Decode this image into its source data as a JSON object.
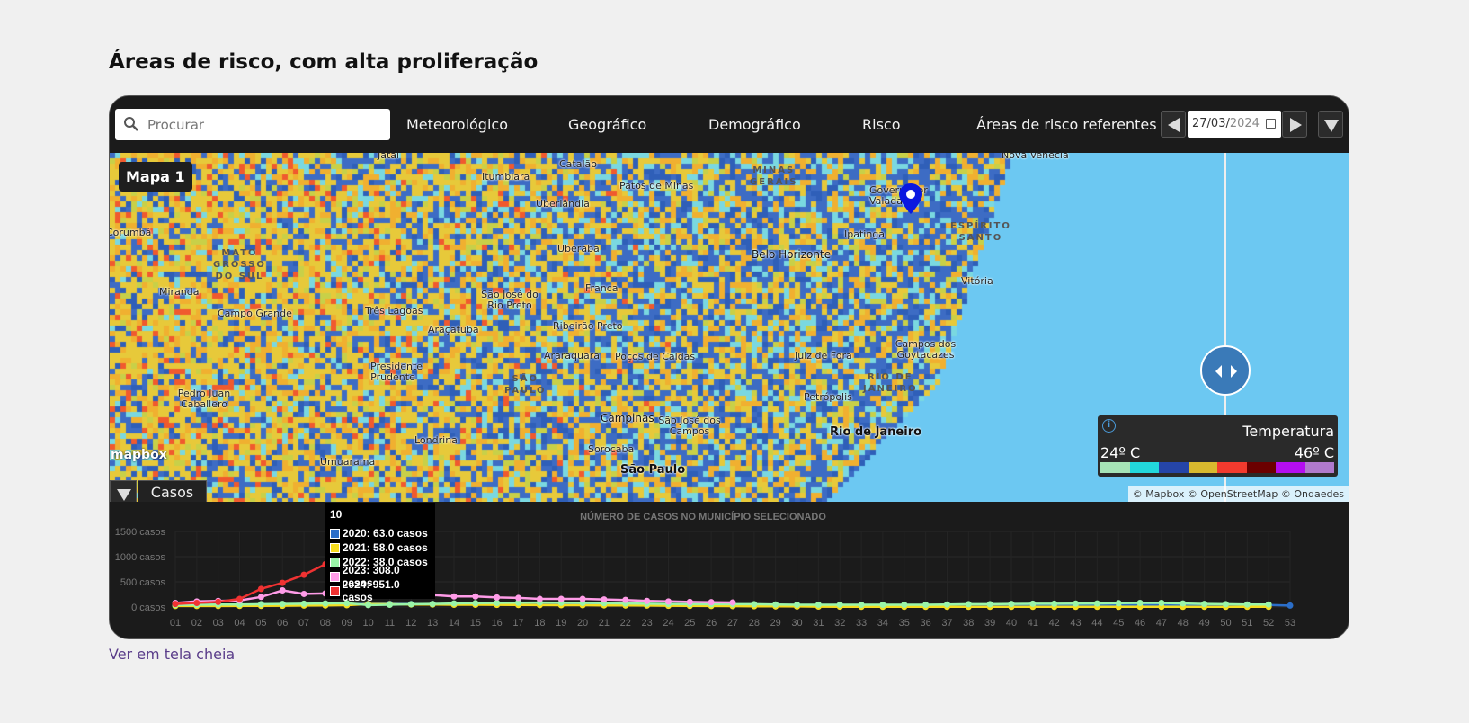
{
  "page": {
    "title": "Áreas de risco, com alta proliferação",
    "fullscreen_link": "Ver em tela cheia"
  },
  "toolbar": {
    "search_placeholder": "Procurar",
    "tabs": [
      "Meteorológico",
      "Geográfico",
      "Demográfico",
      "Risco"
    ],
    "ref_label": "Áreas de risco referentes a",
    "date_day": "27/03/",
    "date_year": "2024"
  },
  "map": {
    "name": "Mapa 1",
    "logo": "mapbox",
    "attribution": "© Mapbox © OpenStreetMap © Ondaedes",
    "cities": [
      "Jataí",
      "Itumbiara",
      "Catalão",
      "Patos de Minas",
      "Uberlândia",
      "Uberaba",
      "Belo Horizonte",
      "Ipatinga",
      "Governador Valadares",
      "Nova Venécia",
      "Vitória",
      "Campo Grande",
      "Miranda",
      "Corumbá",
      "Três Lagoas",
      "São José do Rio Preto",
      "Araçatuba",
      "Franca",
      "Ribeirão Preto",
      "Araraquara",
      "Poços de Caldas",
      "Juiz de Fora",
      "Campos dos Goytacazes",
      "Presidente Prudente",
      "Pedro Juan Caballero",
      "Petrópolis",
      "Rio de Janeiro",
      "Campinas",
      "São José dos Campos",
      "Sorocaba",
      "São Paulo",
      "Londrina",
      "Umuarama"
    ],
    "states": [
      "MATO GROSSO DO SUL",
      "MINAS GERAIS",
      "ESPÍRITO SANTO",
      "SÃO PAULO",
      "RIO DE JANEIRO"
    ],
    "legend": {
      "title": "Temperatura",
      "min_label": "24º C",
      "max_label": "46º C",
      "info_icon": "info-icon",
      "colors": [
        "#a6e3b6",
        "#22d8dc",
        "#2545a8",
        "#d9b92e",
        "#f23a2e",
        "#6b0000",
        "#b40ef0",
        "#b07acc"
      ]
    },
    "bottom_tab": "Casos"
  },
  "chart_data": {
    "type": "line",
    "title": "NÚMERO DE CASOS NO MUNICÍPIO SELECIONADO",
    "y_ticks": [
      "1500 casos",
      "1000 casos",
      "500 casos",
      "0 casos"
    ],
    "ylim": [
      0,
      1500
    ],
    "categories": [
      "01",
      "02",
      "03",
      "04",
      "05",
      "06",
      "07",
      "08",
      "09",
      "10",
      "11",
      "12",
      "13",
      "14",
      "15",
      "16",
      "17",
      "18",
      "19",
      "20",
      "21",
      "22",
      "23",
      "24",
      "25",
      "26",
      "27",
      "28",
      "29",
      "30",
      "31",
      "32",
      "33",
      "34",
      "35",
      "36",
      "37",
      "38",
      "39",
      "40",
      "41",
      "42",
      "43",
      "44",
      "45",
      "46",
      "47",
      "48",
      "49",
      "50",
      "51",
      "52",
      "53"
    ],
    "series": [
      {
        "name": "2020",
        "color": "#2b6ec9",
        "values": [
          35,
          40,
          42,
          45,
          45,
          48,
          50,
          52,
          55,
          63,
          65,
          58,
          55,
          52,
          50,
          48,
          45,
          45,
          42,
          42,
          40,
          40,
          38,
          38,
          38,
          36,
          36,
          35,
          35,
          33,
          33,
          32,
          32,
          32,
          32,
          32,
          32,
          32,
          33,
          33,
          34,
          34,
          35,
          36,
          38,
          40,
          40,
          40,
          38,
          38,
          40,
          40,
          28
        ]
      },
      {
        "name": "2021",
        "color": "#f5dc1e",
        "values": [
          20,
          20,
          20,
          22,
          22,
          25,
          28,
          30,
          35,
          58,
          55,
          50,
          48,
          45,
          45,
          42,
          40,
          38,
          35,
          35,
          32,
          30,
          28,
          25,
          22,
          20,
          18,
          15,
          12,
          10,
          8,
          6,
          5,
          5,
          5,
          5,
          5,
          5,
          5,
          5,
          5,
          5,
          5,
          5,
          5,
          5,
          5,
          5,
          5,
          5,
          5,
          5,
          null
        ]
      },
      {
        "name": "2022",
        "color": "#9af5a8",
        "values": [
          40,
          45,
          48,
          50,
          55,
          60,
          65,
          70,
          75,
          38,
          45,
          55,
          60,
          70,
          75,
          80,
          85,
          88,
          85,
          80,
          75,
          70,
          65,
          60,
          55,
          55,
          55,
          55,
          50,
          45,
          45,
          45,
          45,
          45,
          45,
          45,
          50,
          55,
          55,
          60,
          65,
          65,
          68,
          70,
          75,
          80,
          80,
          70,
          60,
          55,
          50,
          50,
          null
        ]
      },
      {
        "name": "2023",
        "color": "#ff9ce8",
        "values": [
          80,
          110,
          120,
          130,
          200,
          330,
          260,
          270,
          250,
          308,
          300,
          250,
          240,
          210,
          210,
          190,
          180,
          160,
          160,
          160,
          150,
          140,
          120,
          110,
          100,
          95,
          90,
          null,
          null,
          null,
          null,
          null,
          null,
          null,
          null,
          null,
          null,
          null,
          null,
          null,
          null,
          null,
          null,
          null,
          null,
          null,
          null,
          null,
          null,
          null,
          null,
          null,
          null
        ]
      },
      {
        "name": "2024",
        "color": "#f03232",
        "values": [
          60,
          80,
          100,
          160,
          360,
          480,
          640,
          850,
          null,
          951,
          null,
          null,
          null,
          null,
          null,
          null,
          null,
          null,
          null,
          null,
          null,
          null,
          null,
          null,
          null,
          null,
          null,
          null,
          null,
          null,
          null,
          null,
          null,
          null,
          null,
          null,
          null,
          null,
          null,
          null,
          null,
          null,
          null,
          null,
          null,
          null,
          null,
          null,
          null,
          null,
          null,
          null,
          null
        ]
      }
    ],
    "tooltip": {
      "title": "10",
      "rows": [
        {
          "label": "2020: 63.0 casos",
          "color": "#2b6ec9"
        },
        {
          "label": "2021: 58.0 casos",
          "color": "#f5dc1e"
        },
        {
          "label": "2022: 38.0 casos",
          "color": "#9af5a8"
        },
        {
          "label": "2023: 308.0 casos",
          "color": "#ff9ce8"
        },
        {
          "label": "2024: 951.0 casos",
          "color": "#f03232"
        }
      ]
    }
  }
}
